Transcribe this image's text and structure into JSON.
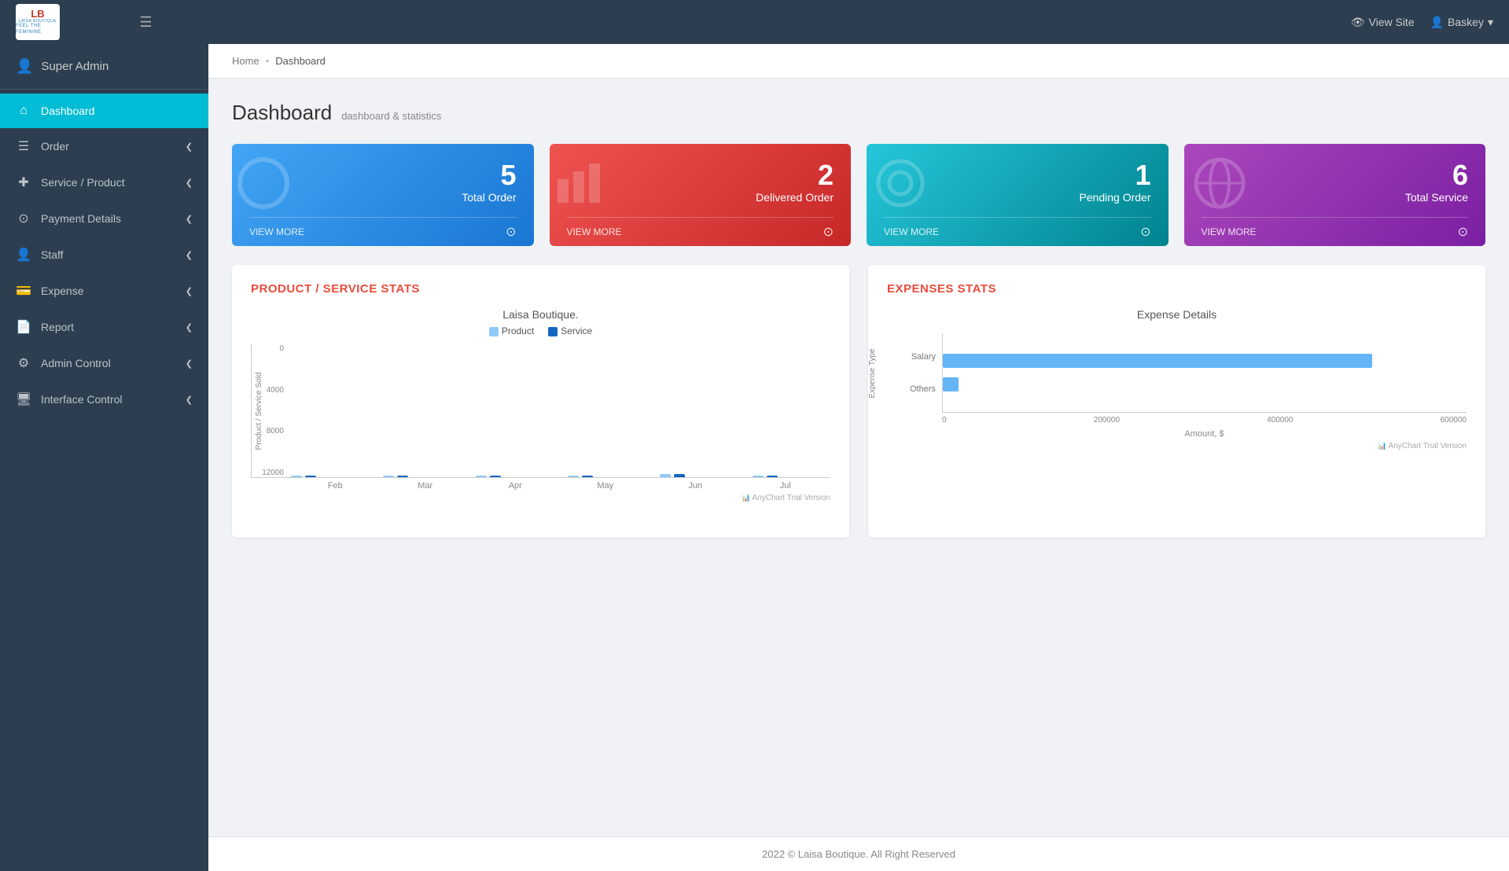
{
  "topnav": {
    "logo_initials": "LB",
    "logo_name": "LAISA BOUTIQUE",
    "logo_tagline": "FEEL THE FEMININE",
    "view_site_label": "View Site",
    "user_label": "Baskey"
  },
  "sidebar": {
    "user_label": "Super Admin",
    "nav_items": [
      {
        "id": "dashboard",
        "label": "Dashboard",
        "icon": "⌂",
        "active": true,
        "has_arrow": false
      },
      {
        "id": "order",
        "label": "Order",
        "icon": "☰",
        "active": false,
        "has_arrow": true
      },
      {
        "id": "service-product",
        "label": "Service / Product",
        "icon": "✚",
        "active": false,
        "has_arrow": true
      },
      {
        "id": "payment-details",
        "label": "Payment Details",
        "icon": "⊙",
        "active": false,
        "has_arrow": true
      },
      {
        "id": "staff",
        "label": "Staff",
        "icon": "👤",
        "active": false,
        "has_arrow": true
      },
      {
        "id": "expense",
        "label": "Expense",
        "icon": "💳",
        "active": false,
        "has_arrow": true
      },
      {
        "id": "report",
        "label": "Report",
        "icon": "📄",
        "active": false,
        "has_arrow": true
      },
      {
        "id": "admin-control",
        "label": "Admin Control",
        "icon": "⚙",
        "active": false,
        "has_arrow": true
      },
      {
        "id": "interface-control",
        "label": "Interface Control",
        "icon": "🖥",
        "active": false,
        "has_arrow": true
      }
    ]
  },
  "breadcrumb": {
    "home": "Home",
    "separator": "•",
    "current": "Dashboard"
  },
  "page": {
    "title": "Dashboard",
    "subtitle": "dashboard & statistics"
  },
  "stat_cards": [
    {
      "id": "total-order",
      "number": "5",
      "label": "Total Order",
      "view_more": "VIEW MORE",
      "color": "blue",
      "bg_icon": "◯"
    },
    {
      "id": "delivered-order",
      "number": "2",
      "label": "Delivered Order",
      "view_more": "VIEW MORE",
      "color": "red",
      "bg_icon": "▮▮"
    },
    {
      "id": "pending-order",
      "number": "1",
      "label": "Pending Order",
      "view_more": "VIEW MORE",
      "color": "teal",
      "bg_icon": "⬤"
    },
    {
      "id": "total-service",
      "number": "6",
      "label": "Total Service",
      "view_more": "VIEW MORE",
      "color": "purple",
      "bg_icon": "🌐"
    }
  ],
  "product_service_chart": {
    "title": "PRODUCT / SERVICE STATS",
    "chart_title": "Laisa Boutique.",
    "legend_product": "Product",
    "legend_service": "Service",
    "y_axis_label": "Product / Service Sold",
    "y_labels": [
      "12000",
      "8000",
      "4000",
      "0"
    ],
    "x_labels": [
      "Feb",
      "Mar",
      "Apr",
      "May",
      "Jun",
      "Jul"
    ],
    "bars": [
      {
        "month": "Feb",
        "product": 0,
        "service": 0
      },
      {
        "month": "Mar",
        "product": 0,
        "service": 0
      },
      {
        "month": "Apr",
        "product": 0,
        "service": 0
      },
      {
        "month": "May",
        "product": 0,
        "service": 0
      },
      {
        "month": "Jun",
        "product": 2,
        "service": 5
      },
      {
        "month": "Jul",
        "product": 0,
        "service": 0
      }
    ],
    "watermark": "AnyChart Trial Version"
  },
  "expenses_chart": {
    "title": "EXPENSES STATS",
    "chart_title": "Expense Details",
    "y_axis_label": "Expense Type",
    "y_labels": [
      "Salary",
      "Others"
    ],
    "x_labels": [
      "0",
      "200000",
      "400000",
      "600000"
    ],
    "x_axis_label": "Amount, $",
    "bars": [
      {
        "label": "Salary",
        "width_pct": 80
      },
      {
        "label": "Others",
        "width_pct": 3
      }
    ],
    "watermark": "AnyChart Trial Version"
  },
  "footer": {
    "text": "2022 © Laisa Boutique. All Right Reserved"
  }
}
